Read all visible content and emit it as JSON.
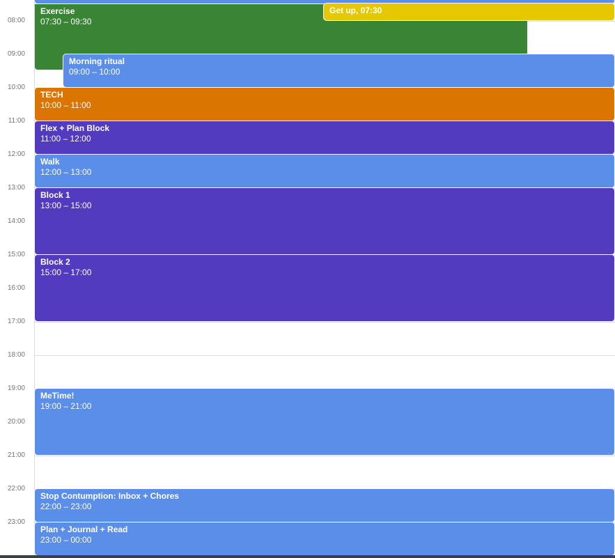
{
  "colors": {
    "green": "#3a8535",
    "yellow": "#e6c800",
    "blue": "#5b8ee9",
    "orange": "#d97500",
    "purple": "#523bbf"
  },
  "hours": [
    "08:00",
    "09:00",
    "10:00",
    "11:00",
    "12:00",
    "13:00",
    "14:00",
    "15:00",
    "16:00",
    "17:00",
    "18:00",
    "19:00",
    "20:00",
    "21:00",
    "22:00",
    "23:00"
  ],
  "events": {
    "exercise": {
      "title": "Exercise",
      "time": "07:30 – 09:30",
      "color": "green"
    },
    "getup": {
      "title": "Get up, 07:30",
      "color": "yellow"
    },
    "morning_ritual": {
      "title": "Morning ritual",
      "time": "09:00 – 10:00",
      "color": "blue"
    },
    "tech": {
      "title": "TECH",
      "time": "10:00 – 11:00",
      "color": "orange"
    },
    "flex": {
      "title": "Flex + Plan Block",
      "time": "11:00 – 12:00",
      "color": "purple"
    },
    "walk": {
      "title": "Walk",
      "time": "12:00 – 13:00",
      "color": "blue"
    },
    "block1": {
      "title": "Block 1",
      "time": "13:00 – 15:00",
      "color": "purple"
    },
    "block2": {
      "title": "Block 2",
      "time": "15:00 – 17:00",
      "color": "purple"
    },
    "metime": {
      "title": "MeTime!",
      "time": "19:00 – 21:00",
      "color": "blue"
    },
    "stop": {
      "title": "Stop Contumption: Inbox + Chores",
      "time": "22:00 – 23:00",
      "color": "blue"
    },
    "plan": {
      "title": "Plan + Journal + Read",
      "time": "23:00 – 00:00",
      "color": "blue"
    }
  }
}
